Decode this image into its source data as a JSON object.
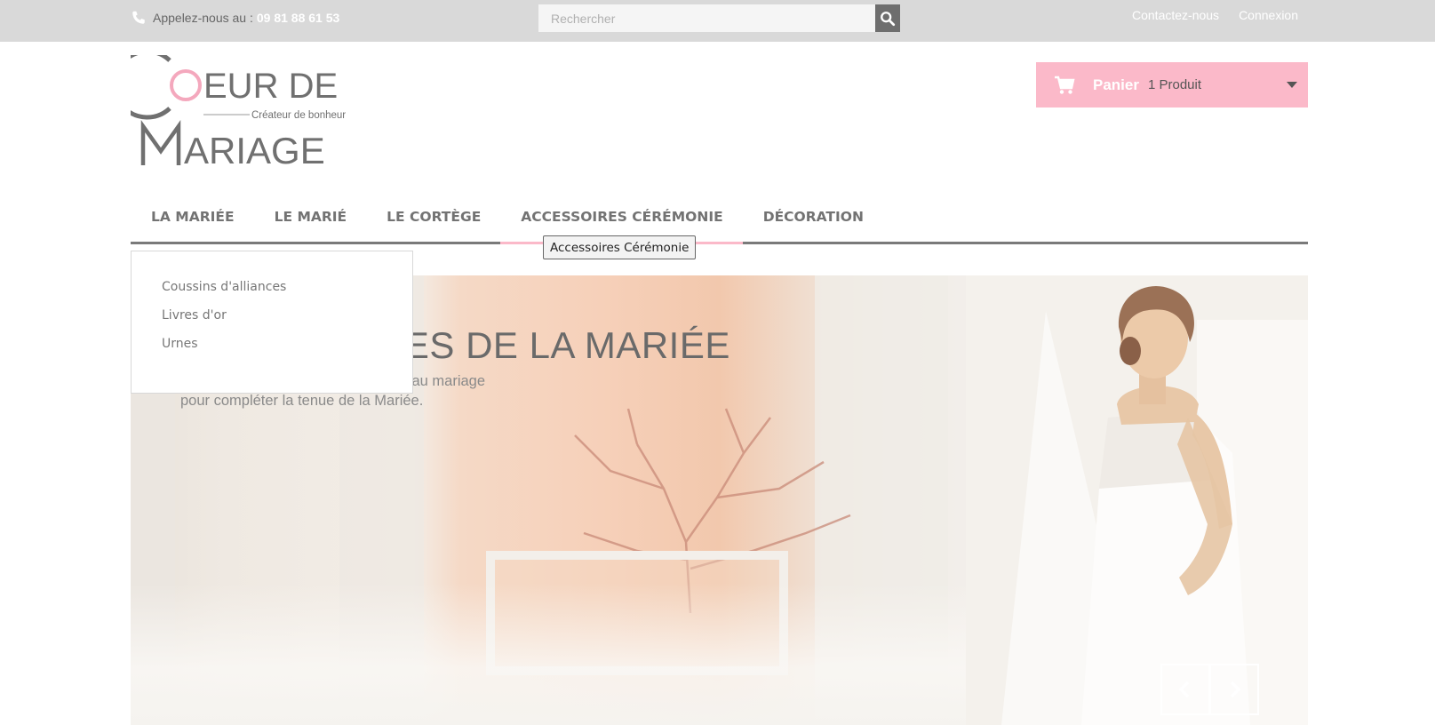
{
  "topbar": {
    "phone_label": "Appelez-nous au :",
    "phone_number": "09 81 88 61 53",
    "search_placeholder": "Rechercher",
    "links": [
      "Contactez-nous",
      "Connexion"
    ]
  },
  "logo": {
    "line1": "EUR DE",
    "tagline": "Créateur de bonheur",
    "line2": "ARIAGE"
  },
  "cart": {
    "label": "Panier",
    "count": "1 Produit"
  },
  "nav": {
    "items": [
      "LA MARIÉE",
      "LE MARIÉ",
      "LE CORTÈGE",
      "ACCESSOIRES CÉRÉMONIE",
      "DÉCORATION"
    ],
    "active_index": 3,
    "tooltip": "Accessoires Cérémonie"
  },
  "dropdown": {
    "items": [
      "Coussins d'alliances",
      "Livres d'or",
      "Urnes"
    ]
  },
  "hero": {
    "title": "ACCESSOIRES DE LA MARIÉE",
    "body": "Découvrez tous nos articles dédiés au mariage pour compléter la tenue de la Mariée."
  },
  "colors": {
    "accent_pink": "#fbb9c9",
    "topbar_bg": "#d9d9d9",
    "nav_text": "#737373"
  }
}
